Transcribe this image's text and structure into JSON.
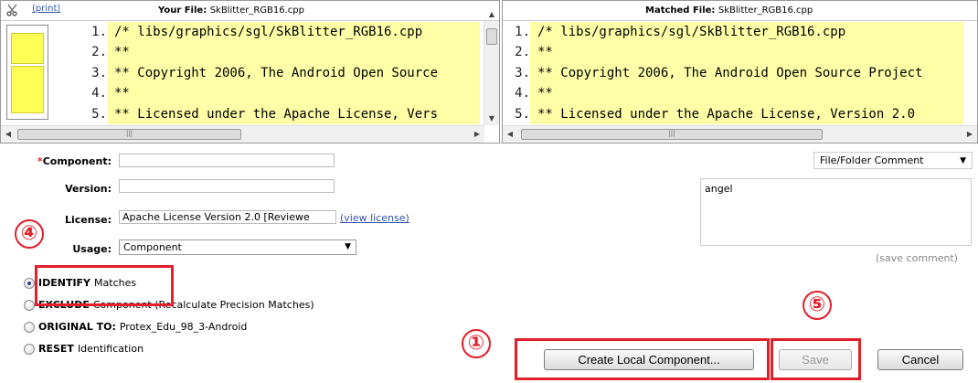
{
  "left_pane": {
    "print_label": "(print)",
    "title_prefix": "Your File:",
    "file_name": "SkBlitter_RGB16.cpp",
    "lines": [
      {
        "num": "1.",
        "text": "/* libs/graphics/sgl/SkBlitter_RGB16.cpp"
      },
      {
        "num": "2.",
        "text": "**"
      },
      {
        "num": "3.",
        "text": "** Copyright 2006, The Android Open Source"
      },
      {
        "num": "4.",
        "text": "**"
      },
      {
        "num": "5.",
        "text": "** Licensed under the Apache License, Vers"
      }
    ]
  },
  "right_pane": {
    "title_prefix": "Matched File:",
    "file_name": "SkBlitter_RGB16.cpp",
    "lines": [
      {
        "num": "1.",
        "text": "/* libs/graphics/sgl/SkBlitter_RGB16.cpp"
      },
      {
        "num": "2.",
        "text": "**"
      },
      {
        "num": "3.",
        "text": "** Copyright 2006, The Android Open Source Project"
      },
      {
        "num": "4.",
        "text": "**"
      },
      {
        "num": "5.",
        "text": "** Licensed under the Apache License, Version 2.0"
      }
    ]
  },
  "form": {
    "required_mark": "*",
    "component_label": "Component:",
    "component_value": "",
    "version_label": "Version:",
    "version_value": "",
    "license_label": "License:",
    "license_value": "Apache License Version 2.0 [Reviewe",
    "view_license": "(view license)",
    "usage_label": "Usage:",
    "usage_value": "Component"
  },
  "radios": [
    {
      "bold": "IDENTIFY",
      "rest": "Matches",
      "checked": true
    },
    {
      "bold": "EXCLUDE",
      "rest": "Component (Recalculate Precision Matches)",
      "checked": false
    },
    {
      "bold": "ORIGINAL TO:",
      "rest": "Protex_Edu_98_3-Android",
      "checked": false
    },
    {
      "bold": "RESET",
      "rest": "Identification",
      "checked": false
    }
  ],
  "comment": {
    "select_value": "File/Folder Comment",
    "text": "angel",
    "save_label": "(save comment)"
  },
  "buttons": {
    "create_local": "Create Local Component...",
    "save": "Save",
    "cancel": "Cancel"
  },
  "markers": {
    "m1": "①",
    "m4": "④",
    "m5": "⑤"
  },
  "colors": {
    "highlight": "#ffffa8",
    "annotation_red": "#e0202a",
    "link": "#3355aa"
  }
}
